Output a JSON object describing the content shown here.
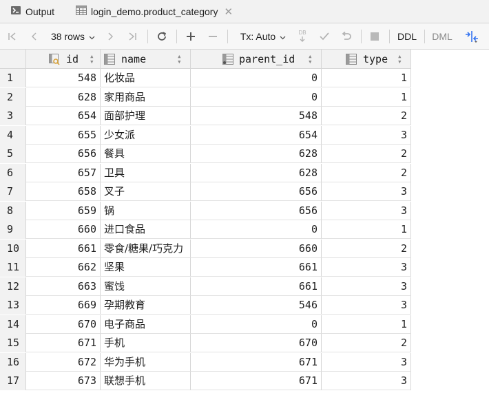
{
  "tabs": [
    {
      "label": "Output"
    },
    {
      "label": "login_demo.product_category"
    }
  ],
  "toolbar": {
    "rows_label": "38 rows",
    "tx_label": "Tx: Auto",
    "db_badge": "DB",
    "ddl_label": "DDL",
    "dml_label": "DML"
  },
  "columns": [
    {
      "name": "id"
    },
    {
      "name": "name"
    },
    {
      "name": "parent_id"
    },
    {
      "name": "type"
    }
  ],
  "rows": [
    {
      "n": "1",
      "id": "548",
      "name": "化妆品",
      "parent_id": "0",
      "type": "1"
    },
    {
      "n": "2",
      "id": "628",
      "name": "家用商品",
      "parent_id": "0",
      "type": "1"
    },
    {
      "n": "3",
      "id": "654",
      "name": "面部护理",
      "parent_id": "548",
      "type": "2"
    },
    {
      "n": "4",
      "id": "655",
      "name": "少女派",
      "parent_id": "654",
      "type": "3"
    },
    {
      "n": "5",
      "id": "656",
      "name": "餐具",
      "parent_id": "628",
      "type": "2"
    },
    {
      "n": "6",
      "id": "657",
      "name": "卫具",
      "parent_id": "628",
      "type": "2"
    },
    {
      "n": "7",
      "id": "658",
      "name": "叉子",
      "parent_id": "656",
      "type": "3"
    },
    {
      "n": "8",
      "id": "659",
      "name": "锅",
      "parent_id": "656",
      "type": "3"
    },
    {
      "n": "9",
      "id": "660",
      "name": "进口食品",
      "parent_id": "0",
      "type": "1"
    },
    {
      "n": "10",
      "id": "661",
      "name": "零食/糖果/巧克力",
      "parent_id": "660",
      "type": "2"
    },
    {
      "n": "11",
      "id": "662",
      "name": "坚果",
      "parent_id": "661",
      "type": "3"
    },
    {
      "n": "12",
      "id": "663",
      "name": "蜜饯",
      "parent_id": "661",
      "type": "3"
    },
    {
      "n": "13",
      "id": "669",
      "name": "孕期教育",
      "parent_id": "546",
      "type": "3"
    },
    {
      "n": "14",
      "id": "670",
      "name": "电子商品",
      "parent_id": "0",
      "type": "1"
    },
    {
      "n": "15",
      "id": "671",
      "name": "手机",
      "parent_id": "670",
      "type": "2"
    },
    {
      "n": "16",
      "id": "672",
      "name": "华为手机",
      "parent_id": "671",
      "type": "3"
    },
    {
      "n": "17",
      "id": "673",
      "name": "联想手机",
      "parent_id": "671",
      "type": "3"
    }
  ],
  "colors": {
    "accent": "#3574f0",
    "key_icon": "#d9a33b"
  }
}
